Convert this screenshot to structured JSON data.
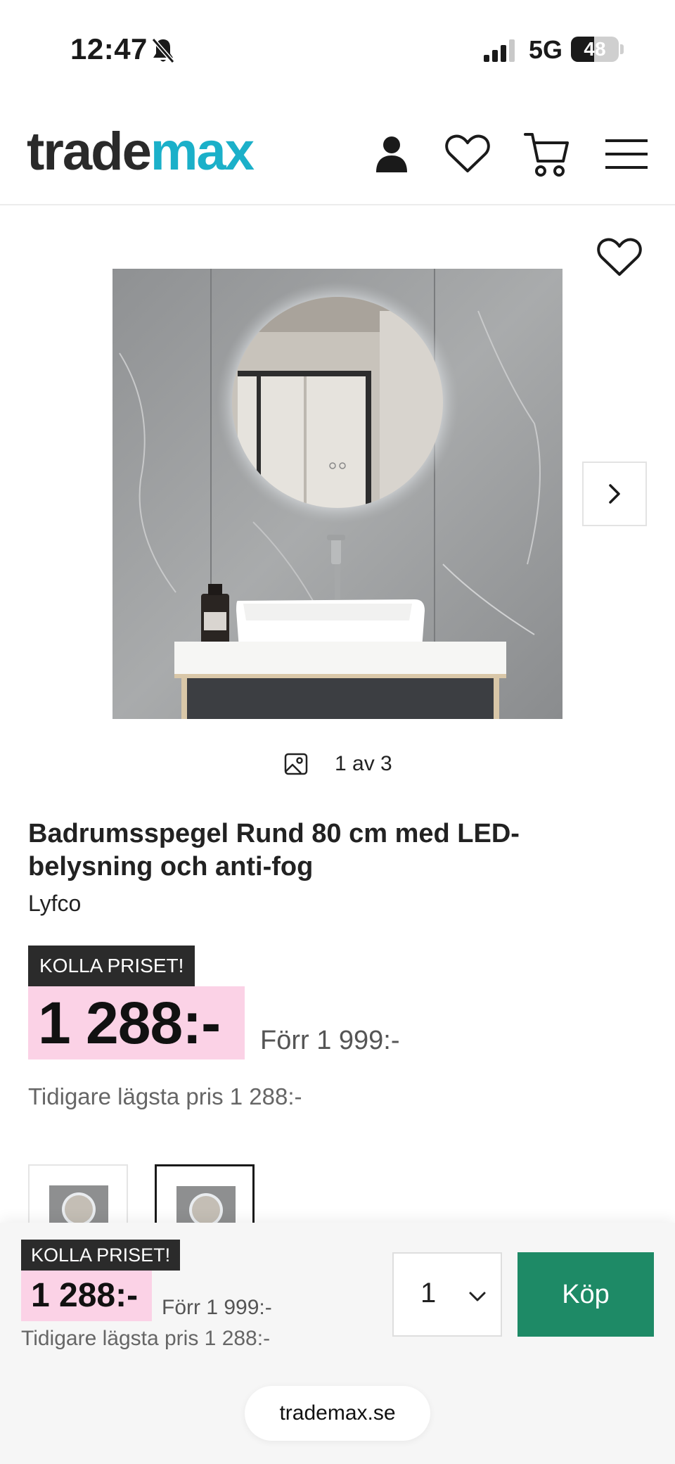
{
  "status_bar": {
    "time": "12:47",
    "network": "5G",
    "battery": "48",
    "battery_level": 0.48
  },
  "header": {
    "logo_part1": "trade",
    "logo_part2": "max",
    "icons": [
      "account-icon",
      "wishlist-icon",
      "cart-icon",
      "menu-icon"
    ]
  },
  "gallery": {
    "counter": "1 av 3",
    "icons": [
      "heart-icon",
      "chevron-right-icon",
      "image-icon"
    ]
  },
  "product": {
    "title": "Badrumsspegel Rund 80 cm med LED-belysning och anti-fog",
    "brand": "Lyfco",
    "badge": "KOLLA PRISET!",
    "price": "1 288:-",
    "old_price": "Förr 1 999:-",
    "lowest_price": "Tidigare lägsta pris 1 288:-"
  },
  "sticky": {
    "badge": "KOLLA PRISET!",
    "price": "1 288:-",
    "old_price": "Förr 1 999:-",
    "lowest_price": "Tidigare lägsta pris 1 288:-",
    "quantity": "1",
    "buy_label": "Köp"
  },
  "browser": {
    "url": "trademax.se"
  },
  "colors": {
    "brand_teal": "#1bb0c9",
    "buy_green": "#1e8a66",
    "price_highlight": "#fbd2e6",
    "badge_dark": "#2b2b2b"
  }
}
